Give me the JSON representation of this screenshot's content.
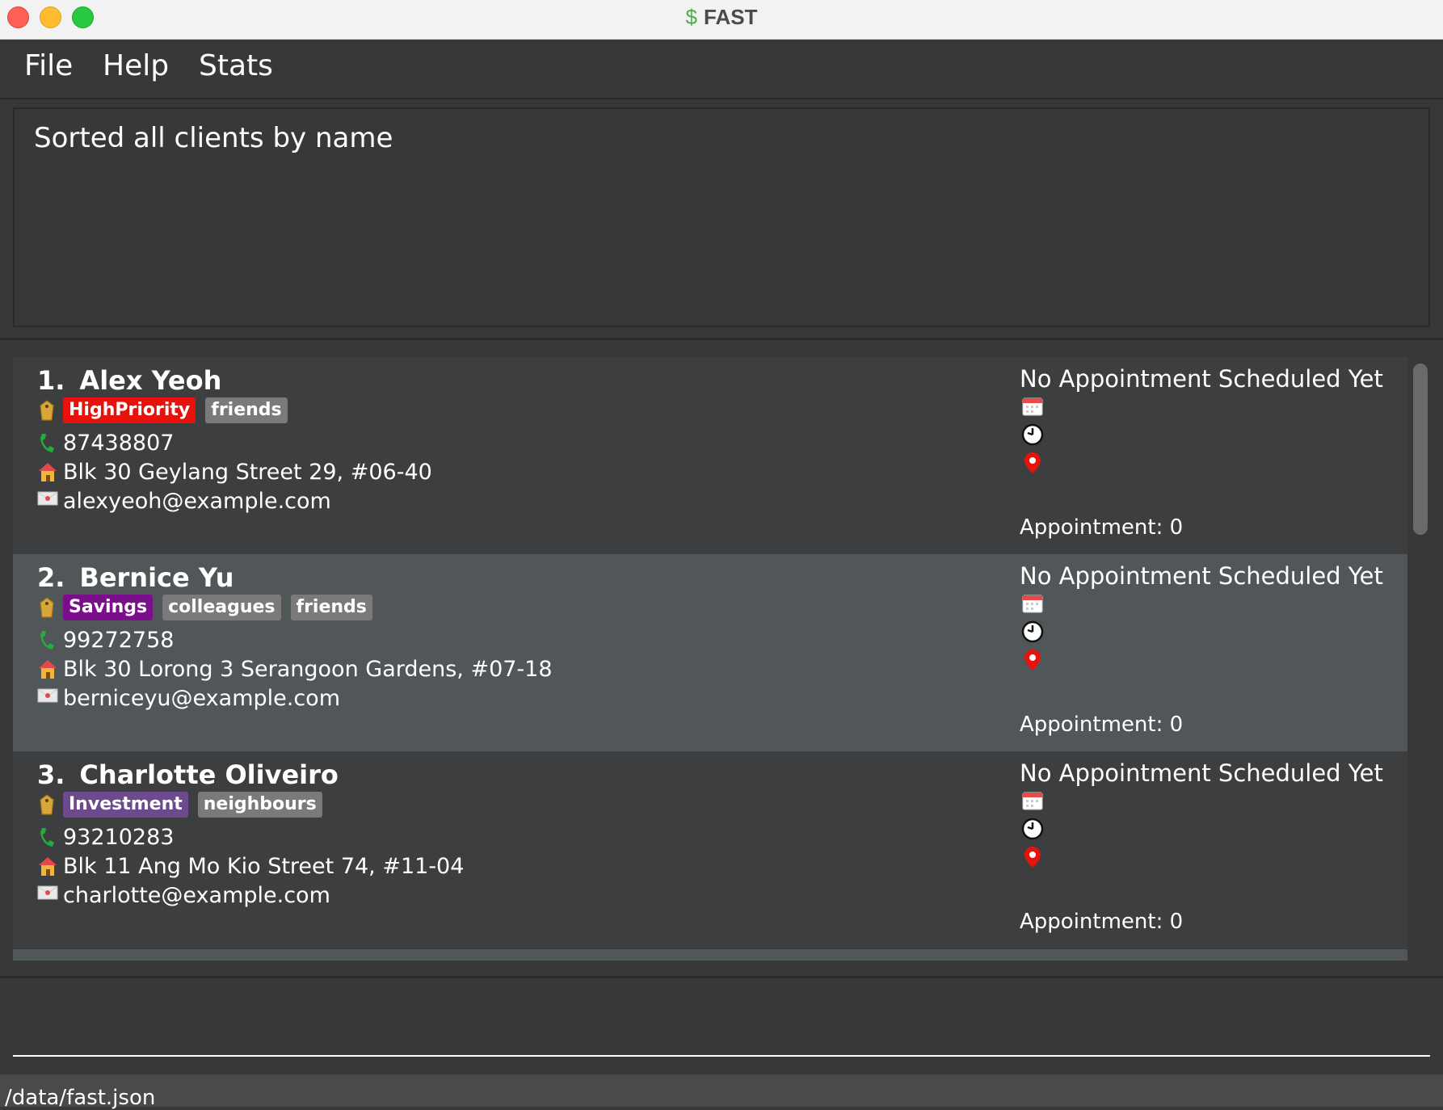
{
  "window": {
    "title": "FAST",
    "title_icon": "dollar-sign-icon"
  },
  "menu": {
    "file": "File",
    "help": "Help",
    "stats": "Stats"
  },
  "result": {
    "text": "Sorted all clients by name"
  },
  "clients": [
    {
      "index": "1.",
      "name": "Alex Yeoh",
      "tags": [
        {
          "label": "HighPriority",
          "color": "#e8120c"
        },
        {
          "label": "friends",
          "color": "#7a7a7a"
        }
      ],
      "phone": "87438807",
      "address": "Blk 30 Geylang Street 29, #06-40",
      "email": "alexyeoh@example.com",
      "appointment_status": "No Appointment Scheduled Yet",
      "appointment_count": "Appointment: 0"
    },
    {
      "index": "2.",
      "name": "Bernice Yu",
      "tags": [
        {
          "label": "Savings",
          "color": "#7b0e8a"
        },
        {
          "label": "colleagues",
          "color": "#7a7a7a"
        },
        {
          "label": "friends",
          "color": "#7a7a7a"
        }
      ],
      "phone": "99272758",
      "address": "Blk 30 Lorong 3 Serangoon Gardens, #07-18",
      "email": "berniceyu@example.com",
      "appointment_status": "No Appointment Scheduled Yet",
      "appointment_count": "Appointment: 0"
    },
    {
      "index": "3.",
      "name": "Charlotte Oliveiro",
      "tags": [
        {
          "label": "Investment",
          "color": "#6d4a8e"
        },
        {
          "label": "neighbours",
          "color": "#7a7a7a"
        }
      ],
      "phone": "93210283",
      "address": "Blk 11 Ang Mo Kio Street 74, #11-04",
      "email": "charlotte@example.com",
      "appointment_status": "No Appointment Scheduled Yet",
      "appointment_count": "Appointment: 0"
    }
  ],
  "icons": {
    "tag": "tag-icon",
    "phone": "phone-icon",
    "address": "house-icon",
    "email": "envelope-icon",
    "date": "calendar-icon",
    "time": "clock-icon",
    "location": "location-pin-icon"
  },
  "command": {
    "value": "",
    "placeholder": ""
  },
  "status": {
    "path": "/data/fast.json"
  }
}
